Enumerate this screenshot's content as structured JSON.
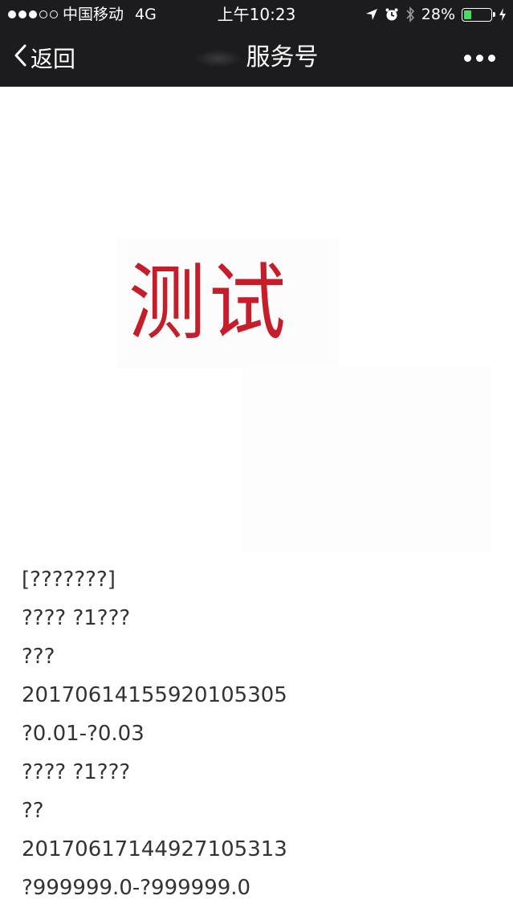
{
  "status_bar": {
    "carrier": "中国移动",
    "network": "4G",
    "time": "上午10:23",
    "battery_percent": "28%",
    "battery_level": 0.28,
    "signal_bars": 3
  },
  "nav": {
    "back_label": "返回",
    "title": "服务号"
  },
  "image": {
    "text": "测试",
    "color": "#c51d2a"
  },
  "message_lines": [
    "[???????]",
    "???? ?1???",
    "???",
    "20170614155920105305",
    "?0.01-?0.03",
    "???? ?1???",
    "??",
    "20170617144927105313",
    "?999999.0-?999999.0"
  ]
}
